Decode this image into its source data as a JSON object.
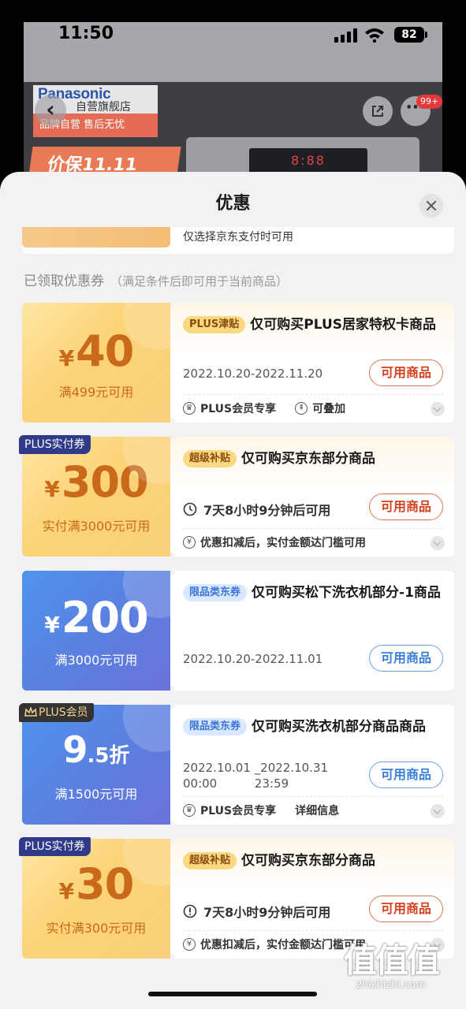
{
  "status_bar": {
    "time": "11:50",
    "battery": "82"
  },
  "background": {
    "brand": "Panasonic",
    "store": "自营旗舰店",
    "subtitle": "品牌自营  售后无忧",
    "promo": "价保11.11",
    "panel_display": "8:88",
    "more_badge": "99+"
  },
  "sheet": {
    "title": "优惠",
    "partial_card_text": "仅选择京东支付时可用",
    "section_title": "已领取优惠券",
    "section_note": "（满足条件后即可用于当前商品）"
  },
  "coupons": [
    {
      "style": "gold",
      "currency": "¥",
      "amount": "40",
      "condition": "满499元可用",
      "tag": "PLUS津贴",
      "title": "仅可购买PLUS居家特权卡商品",
      "date": "2022.10.20-2022.11.20",
      "button": "可用商品",
      "foot_items": [
        "PLUS会员专享",
        "可叠加"
      ]
    },
    {
      "style": "gold",
      "corner": "PLUS实付券",
      "currency": "¥",
      "amount": "300",
      "condition": "实付满3000元可用",
      "tag": "超级补贴",
      "title": "仅可购买京东部分商品",
      "timer": "7天8小时9分钟后可用",
      "button": "可用商品",
      "foot_items": [
        "优惠扣减后，实付金额达门槛可用"
      ]
    },
    {
      "style": "blue",
      "currency": "¥",
      "amount": "200",
      "condition": "满3000元可用",
      "tag": "限品类东券",
      "title": "仅可购买松下洗衣机部分-1商品",
      "date": "2022.10.20-2022.11.01",
      "button": "可用商品"
    },
    {
      "style": "blue",
      "corner": "PLUS会员",
      "amount": "9",
      "amount_suffix": ".5折",
      "condition": "满1500元可用",
      "tag": "限品类东券",
      "title": "仅可购买洗衣机部分商品商品",
      "date_line1": "2022.10.01 _2022.10.31",
      "date_line2": "00:00          23:59",
      "button": "可用商品",
      "foot_items": [
        "PLUS会员专享",
        "详细信息"
      ]
    },
    {
      "style": "gold",
      "corner": "PLUS实付券",
      "currency": "¥",
      "amount": "30",
      "condition": "实付满300元可用",
      "tag": "超级补贴",
      "title": "仅可购买京东部分商品",
      "timer": "7天8小时9分钟后可用",
      "button": "可用商品",
      "foot_items": [
        "优惠扣减后，实付金额达门槛可用"
      ]
    }
  ],
  "watermark": {
    "mark": "值值值",
    "url": "zhizhizhi.com"
  }
}
